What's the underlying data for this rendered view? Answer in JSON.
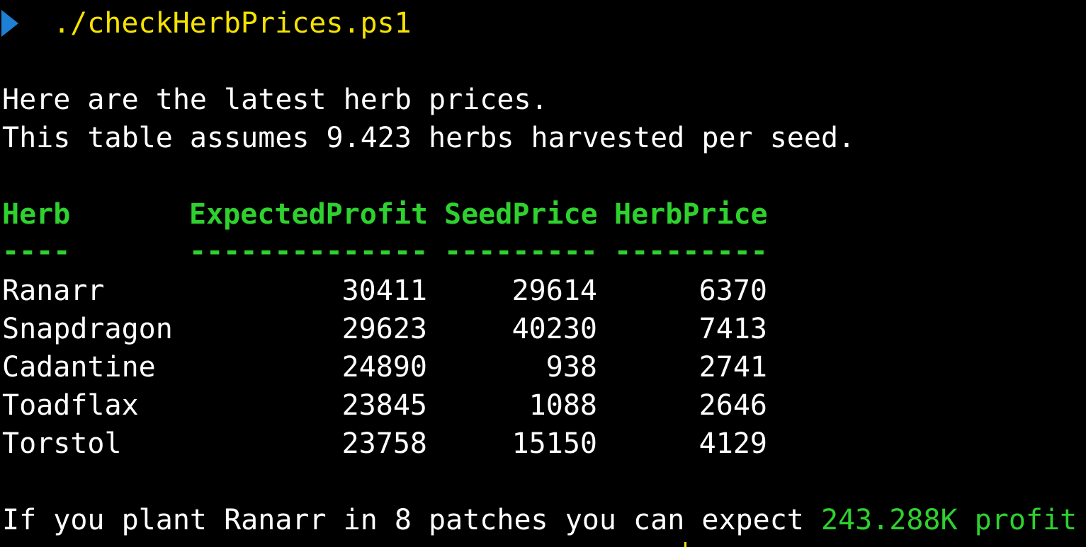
{
  "prompt": {
    "command": "./checkHerbPrices.ps1"
  },
  "intro": {
    "line1": "Here are the latest herb prices.",
    "line2": "This table assumes 9.423 herbs harvested per seed."
  },
  "table": {
    "headers": [
      "Herb",
      "ExpectedProfit",
      "SeedPrice",
      "HerbPrice"
    ],
    "separators": [
      "----",
      "--------------",
      "---------",
      "---------"
    ],
    "rows": [
      {
        "herb": "Ranarr",
        "profit": "30411",
        "seed": "29614",
        "herbprice": "6370"
      },
      {
        "herb": "Snapdragon",
        "profit": "29623",
        "seed": "40230",
        "herbprice": "7413"
      },
      {
        "herb": "Cadantine",
        "profit": "24890",
        "seed": "938",
        "herbprice": "2741"
      },
      {
        "herb": "Toadflax",
        "profit": "23845",
        "seed": "1088",
        "herbprice": "2646"
      },
      {
        "herb": "Torstol",
        "profit": "23758",
        "seed": "15150",
        "herbprice": "4129"
      }
    ]
  },
  "summary": {
    "prefix": "If you plant Ranarr in 8 patches you can expect ",
    "highlight": "243.288K profit"
  },
  "colors": {
    "background": "#000000",
    "prompt_arrow": "#1e7fd6",
    "command": "#f5e300",
    "header": "#2ed12e",
    "text": "#ffffff"
  }
}
